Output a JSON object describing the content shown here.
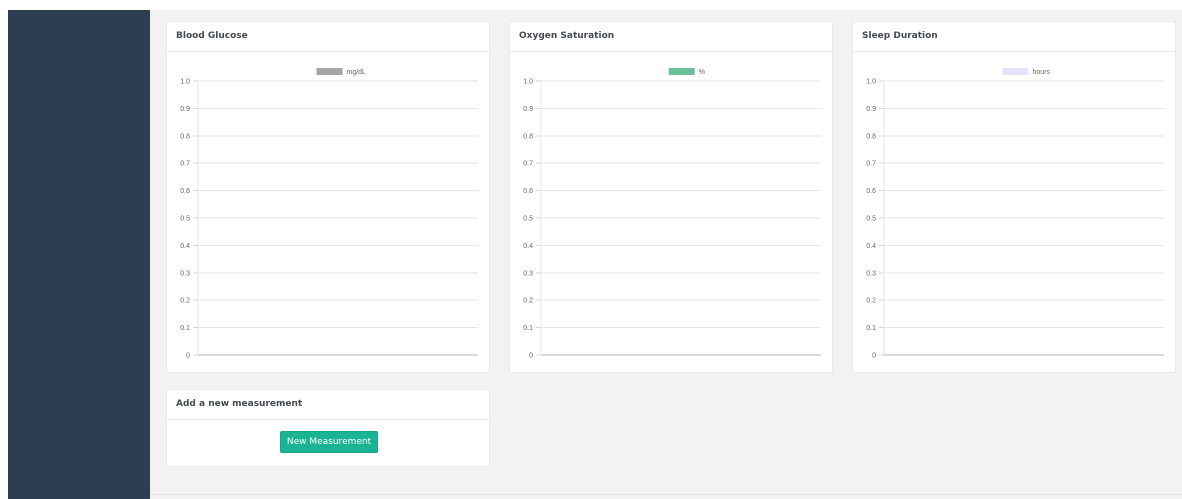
{
  "charts": [
    {
      "title": "Blood Glucose",
      "chart_data": {
        "type": "line",
        "title": "",
        "xlabel": "",
        "ylabel": "",
        "x": [],
        "series": [
          {
            "name": "mg/dL",
            "values": [],
            "color": "#a6a6a6"
          }
        ],
        "ylim": [
          0,
          1.0
        ],
        "yticks": [
          "1.0",
          "0.9",
          "0.8",
          "0.7",
          "0.6",
          "0.5",
          "0.4",
          "0.3",
          "0.2",
          "0.1",
          "0"
        ],
        "grid": true,
        "legend": "top-center"
      }
    },
    {
      "title": "Oxygen Saturation",
      "chart_data": {
        "type": "line",
        "title": "",
        "xlabel": "",
        "ylabel": "",
        "x": [],
        "series": [
          {
            "name": "%",
            "values": [],
            "color": "#6cbf9c"
          }
        ],
        "ylim": [
          0,
          1.0
        ],
        "yticks": [
          "1.0",
          "0.9",
          "0.8",
          "0.7",
          "0.6",
          "0.5",
          "0.4",
          "0.3",
          "0.2",
          "0.1",
          "0"
        ],
        "grid": true,
        "legend": "top-center"
      }
    },
    {
      "title": "Sleep Duration",
      "chart_data": {
        "type": "line",
        "title": "",
        "xlabel": "",
        "ylabel": "",
        "x": [],
        "series": [
          {
            "name": "hours",
            "values": [],
            "color": "#e3e4fa"
          }
        ],
        "ylim": [
          0,
          1.0
        ],
        "yticks": [
          "1.0",
          "0.9",
          "0.8",
          "0.7",
          "0.6",
          "0.5",
          "0.4",
          "0.3",
          "0.2",
          "0.1",
          "0"
        ],
        "grid": true,
        "legend": "top-center"
      }
    }
  ],
  "measurement": {
    "title": "Add a new measurement",
    "button_label": "New Measurement"
  },
  "colors": {
    "sidebar": "#2c3e50",
    "background": "#f2f2f2",
    "accent": "#1ab394"
  }
}
